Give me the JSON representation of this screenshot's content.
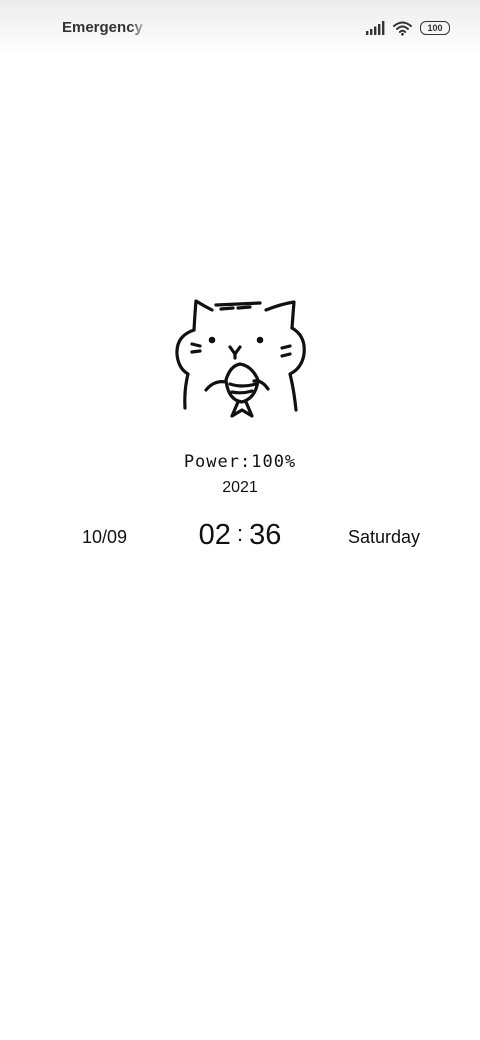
{
  "status_bar": {
    "carrier_text": "Emergency c",
    "battery_level": "100",
    "icons": [
      "signal-icon",
      "wifi-icon",
      "battery-icon"
    ]
  },
  "lock_screen": {
    "illustration": "cat-holding-fish-icon",
    "power_text": "Power:100%",
    "year": "2021",
    "date": "10/09",
    "time_hours": "02",
    "time_separator": ":",
    "time_minutes": "36",
    "weekday": "Saturday"
  },
  "colors": {
    "background": "#ffffff",
    "text": "#111111"
  }
}
